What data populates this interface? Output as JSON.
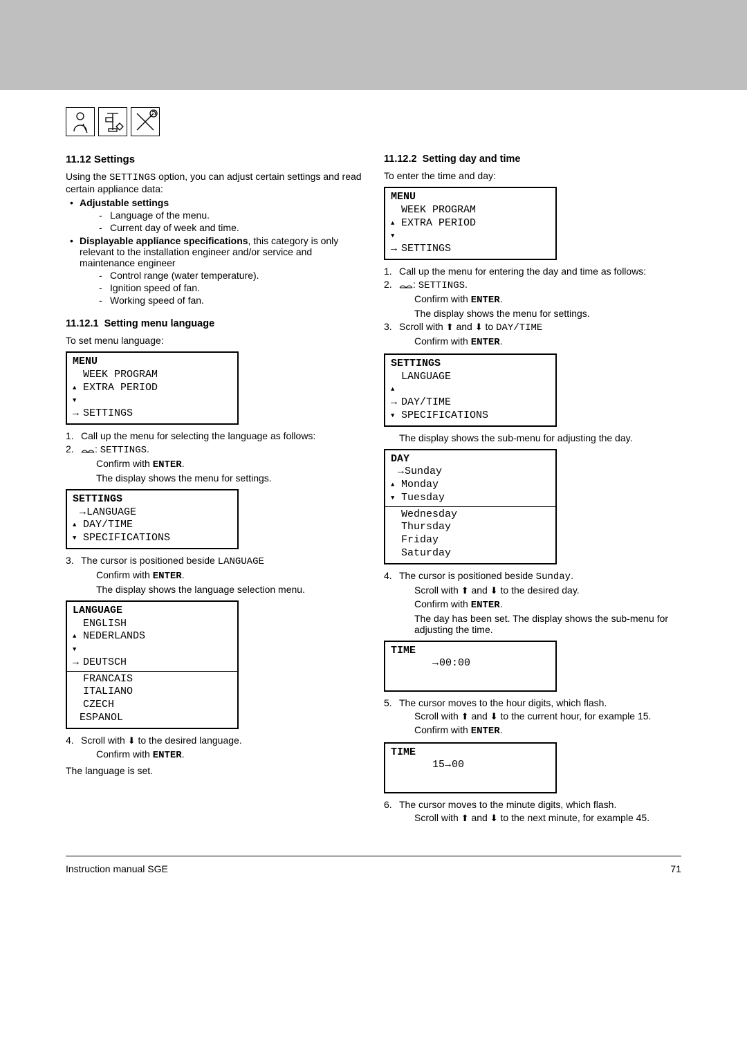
{
  "section": {
    "num": "11.12",
    "title": "Settings",
    "intro_a": "Using the ",
    "intro_mono": "SETTINGS",
    "intro_b": " option, you can adjust certain settings and read certain appliance data:"
  },
  "adj_heading": "Adjustable settings",
  "adj_items": [
    "Language of the menu.",
    "Current day of week and time."
  ],
  "disp_heading_a": "Displayable appliance specifications",
  "disp_heading_b": ", this category is only relevant to the installation engineer and/or service and maintenance engineer",
  "disp_items": [
    "Control range (water temperature).",
    "Ignition speed of fan.",
    "Working speed of fan."
  ],
  "sub1": {
    "num": "11.12.1",
    "title": "Setting menu language",
    "lead": "To set menu language:"
  },
  "menuBox": {
    "title": "MENU",
    "line1": "WEEK PROGRAM",
    "line2": "EXTRA PERIOD",
    "line3": "SETTINGS"
  },
  "steps1": {
    "s1": "Call up the menu for selecting the language as follows:",
    "s2a": ": ",
    "s2mono": "SETTINGS",
    "s2b": ".",
    "confirmEnter": "Confirm with ",
    "enter": "ENTER",
    "dot": ".",
    "showSettings": "The display shows the menu for settings."
  },
  "settingsBox": {
    "title": "SETTINGS",
    "line1": "LANGUAGE",
    "line2": "DAY/TIME",
    "line3": "SPECIFICATIONS"
  },
  "step3a": "The cursor is positioned beside ",
  "step3mono": "LANGUAGE",
  "step3showLang": "The display shows the language selection menu.",
  "langBox": {
    "title": "LANGUAGE",
    "l1": "ENGLISH",
    "l2": "NEDERLANDS",
    "l3": "DEUTSCH",
    "l4": "FRANCAIS",
    "l5": "ITALIANO",
    "l6": "CZECH",
    "l7": "ESPANOL"
  },
  "step4a": "Scroll with ",
  "step4b": " to the desired language.",
  "langSet": "The language is set.",
  "sub2": {
    "num": "11.12.2",
    "title": "Setting day and time",
    "lead": "To enter the time and day:"
  },
  "rsteps": {
    "s1": "Call up the menu for entering the day and time as follows:",
    "s3a": "Scroll with ",
    "s3b": " and ",
    "s3c": " to ",
    "s3mono": "DAY/TIME",
    "showSubmenu": "The display shows the sub-menu for adjusting the day."
  },
  "settingsBox2": {
    "title": "SETTINGS",
    "line1": "LANGUAGE",
    "line2": "DAY/TIME",
    "line3": "SPECIFICATIONS"
  },
  "dayBox": {
    "title": "DAY",
    "d1": "Sunday",
    "d2": "Monday",
    "d3": "Tuesday",
    "d4": "Wednesday",
    "d5": "Thursday",
    "d6": "Friday",
    "d7": "Saturday"
  },
  "r4a": "The cursor is positioned beside ",
  "r4mono": "Sunday",
  "r4dot": ".",
  "r4scroll_a": "Scroll with ",
  "r4scroll_b": " and ",
  "r4scroll_c": " to the desired day.",
  "r4tail": "The day has been set. The display shows the sub-menu for adjusting the time.",
  "timeBox1": {
    "title": "TIME",
    "value": "00:00"
  },
  "r5a": "The cursor moves to the hour digits, which flash.",
  "r5b_a": "Scroll with ",
  "r5b_b": " and ",
  "r5b_c": " to the current hour, for example 15.",
  "timeBox2": {
    "title": "TIME",
    "value": "15",
    "value2": "00"
  },
  "r6a": "The cursor moves to the minute digits, which flash.",
  "r6b_a": "Scroll with ",
  "r6b_b": " and ",
  "r6b_c": " to the next minute, for example 45.",
  "footer": {
    "left": "Instruction manual SGE",
    "right": "71"
  }
}
